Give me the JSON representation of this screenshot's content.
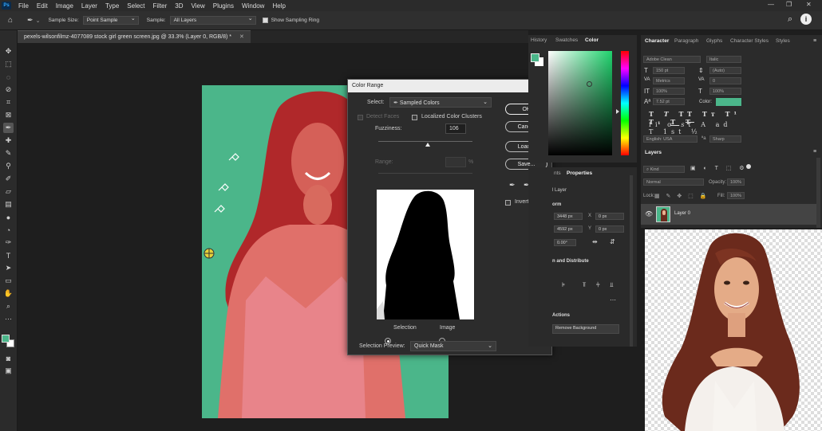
{
  "app": {
    "logo": "Ps",
    "menu": [
      "File",
      "Edit",
      "Image",
      "Layer",
      "Type",
      "Select",
      "Filter",
      "3D",
      "View",
      "Plugins",
      "Window",
      "Help"
    ]
  },
  "options_bar": {
    "sample_size_label": "Sample Size:",
    "sample_size_value": "Point Sample",
    "sample_label": "Sample:",
    "sample_value": "All Layers",
    "sampling_ring_label": "Show Sampling Ring"
  },
  "document": {
    "tab_title": "pexels-wilsonfilmz-4077089 stock girl green screen.jpg @ 33.3% (Layer 0, RGB/8) *"
  },
  "color_range": {
    "title": "Color Range",
    "select_label": "Select:",
    "select_value": "Sampled Colors",
    "detect_faces_label": "Detect Faces",
    "localized_label": "Localized Color Clusters",
    "fuzziness_label": "Fuzziness:",
    "fuzziness_value": "106",
    "range_label": "Range:",
    "range_unit": "%",
    "selection_radio": "Selection",
    "image_radio": "Image",
    "preview_label": "Selection Preview:",
    "preview_value": "Quick Mask",
    "buttons": {
      "ok": "OK",
      "cancel": "Cancel",
      "load": "Load...",
      "save": "Save..."
    },
    "invert_label": "Invert"
  },
  "color_panel": {
    "tabs": [
      "History",
      "Swatches",
      "Color"
    ],
    "active_tab": "Color",
    "foreground": "#4bb68a"
  },
  "character_panel": {
    "tabs": [
      "Character",
      "Paragraph",
      "Glyphs",
      "Character Styles",
      "Styles"
    ],
    "font_family": "Adobe Clean",
    "font_style": "Italic",
    "size": "150 pt",
    "leading": "(Auto)",
    "kerning": "Metrics",
    "tracking": "0",
    "vscale": "100%",
    "hscale": "100%",
    "baseline": "7.52 pt",
    "color_label": "Color:",
    "color_swatch": "#4bb68a",
    "language": "English: USA",
    "antialias": "Sharp"
  },
  "properties_panel": {
    "tabs": [
      "nts",
      "Properties"
    ],
    "layer_label": "l Layer",
    "transform_label": "orm",
    "w_value": "3448 px",
    "h_value": "4592 px",
    "x_value": "0 px",
    "y_value": "0 px",
    "angle_value": "0.00°",
    "align_label": "n and Distribute",
    "actions_label": "Actions",
    "remove_bg_label": "Remove Background"
  },
  "layers_panel": {
    "title": "Layers",
    "kind_label": "Kind",
    "blend_mode": "Normal",
    "opacity_label": "Opacity:",
    "opacity_value": "100%",
    "lock_label": "Lock:",
    "fill_label": "Fill:",
    "fill_value": "100%",
    "layer_name": "Layer 0"
  }
}
